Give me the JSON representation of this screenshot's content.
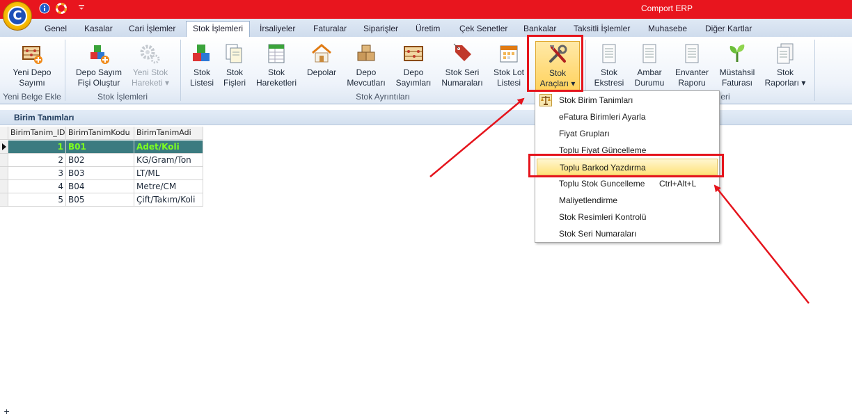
{
  "app": {
    "title": "Comport ERP",
    "logo_letter": "C"
  },
  "tabs": [
    {
      "label": "Genel"
    },
    {
      "label": "Kasalar"
    },
    {
      "label": "Cari İşlemler"
    },
    {
      "label": "Stok İşlemleri",
      "active": true
    },
    {
      "label": "İrsaliyeler"
    },
    {
      "label": "Faturalar"
    },
    {
      "label": "Siparişler"
    },
    {
      "label": "Üretim"
    },
    {
      "label": "Çek Senetler"
    },
    {
      "label": "Bankalar"
    },
    {
      "label": "Taksitli İşlemler"
    },
    {
      "label": "Muhasebe"
    },
    {
      "label": "Diğer Kartlar"
    }
  ],
  "ribbon": {
    "groups": [
      {
        "label": "Yeni Belge Ekle"
      },
      {
        "label": "Stok İşlemleri"
      },
      {
        "label": "Stok Ayrıntıları"
      },
      {
        "label": "eri"
      }
    ],
    "buttons": [
      {
        "line1": "Yeni Depo",
        "line2": "Sayımı"
      },
      {
        "line1": "Depo Sayım",
        "line2": "Fişi Oluştur"
      },
      {
        "line1": "Yeni Stok",
        "line2": "Hareketi ▾",
        "disabled": true
      },
      {
        "line1": "Stok",
        "line2": "Listesi"
      },
      {
        "line1": "Stok",
        "line2": "Fişleri"
      },
      {
        "line1": "Stok",
        "line2": "Hareketleri"
      },
      {
        "line1": "Depolar",
        "line2": ""
      },
      {
        "line1": "Depo",
        "line2": "Mevcutları"
      },
      {
        "line1": "Depo",
        "line2": "Sayımları"
      },
      {
        "line1": "Stok Seri",
        "line2": "Numaraları"
      },
      {
        "line1": "Stok Lot",
        "line2": "Listesi"
      },
      {
        "line1": "Stok",
        "line2": "Araçları ▾",
        "highlighted": true
      },
      {
        "line1": "Stok",
        "line2": "Ekstresi"
      },
      {
        "line1": "Ambar",
        "line2": "Durumu"
      },
      {
        "line1": "Envanter",
        "line2": "Raporu"
      },
      {
        "line1": "Müstahsil",
        "line2": "Faturası"
      },
      {
        "line1": "Stok",
        "line2": "Raporları ▾"
      }
    ]
  },
  "section": {
    "title": "Birim Tanımları"
  },
  "grid": {
    "columns": [
      "BirimTanim_ID",
      "BirimTanimKodu",
      "BirimTanimAdi"
    ],
    "rows": [
      {
        "id": "1",
        "code": "B01",
        "name": "Adet/Koli"
      },
      {
        "id": "2",
        "code": "B02",
        "name": "KG/Gram/Ton"
      },
      {
        "id": "3",
        "code": "B03",
        "name": "LT/ML"
      },
      {
        "id": "4",
        "code": "B04",
        "name": "Metre/CM"
      },
      {
        "id": "5",
        "code": "B05",
        "name": "Çift/Takım/Koli"
      }
    ],
    "new_row_symbol": "+"
  },
  "menu": {
    "items": [
      {
        "label": "Stok Birim Tanimları",
        "shortcut": ""
      },
      {
        "label": "eFatura Birimleri Ayarla",
        "shortcut": ""
      },
      {
        "label": "Fiyat Grupları",
        "shortcut": ""
      },
      {
        "label": "Toplu Fiyat Güncelleme",
        "shortcut": ""
      },
      {
        "label": "Toplu Barkod Yazdırma",
        "shortcut": "",
        "hover": true
      },
      {
        "label": "Toplu Stok Guncelleme",
        "shortcut": "Ctrl+Alt+L"
      },
      {
        "label": "Maliyetlendirme",
        "shortcut": ""
      },
      {
        "label": "Stok Resimleri Kontrolü",
        "shortcut": ""
      },
      {
        "label": "Stok Seri Numaraları",
        "shortcut": ""
      }
    ]
  },
  "colors": {
    "titlebar": "#e8151e",
    "annotation": "#e5141c",
    "selected_row": "#3b7b80",
    "selected_text": "#7dff1f",
    "menu_hover": "#ffe27a"
  }
}
